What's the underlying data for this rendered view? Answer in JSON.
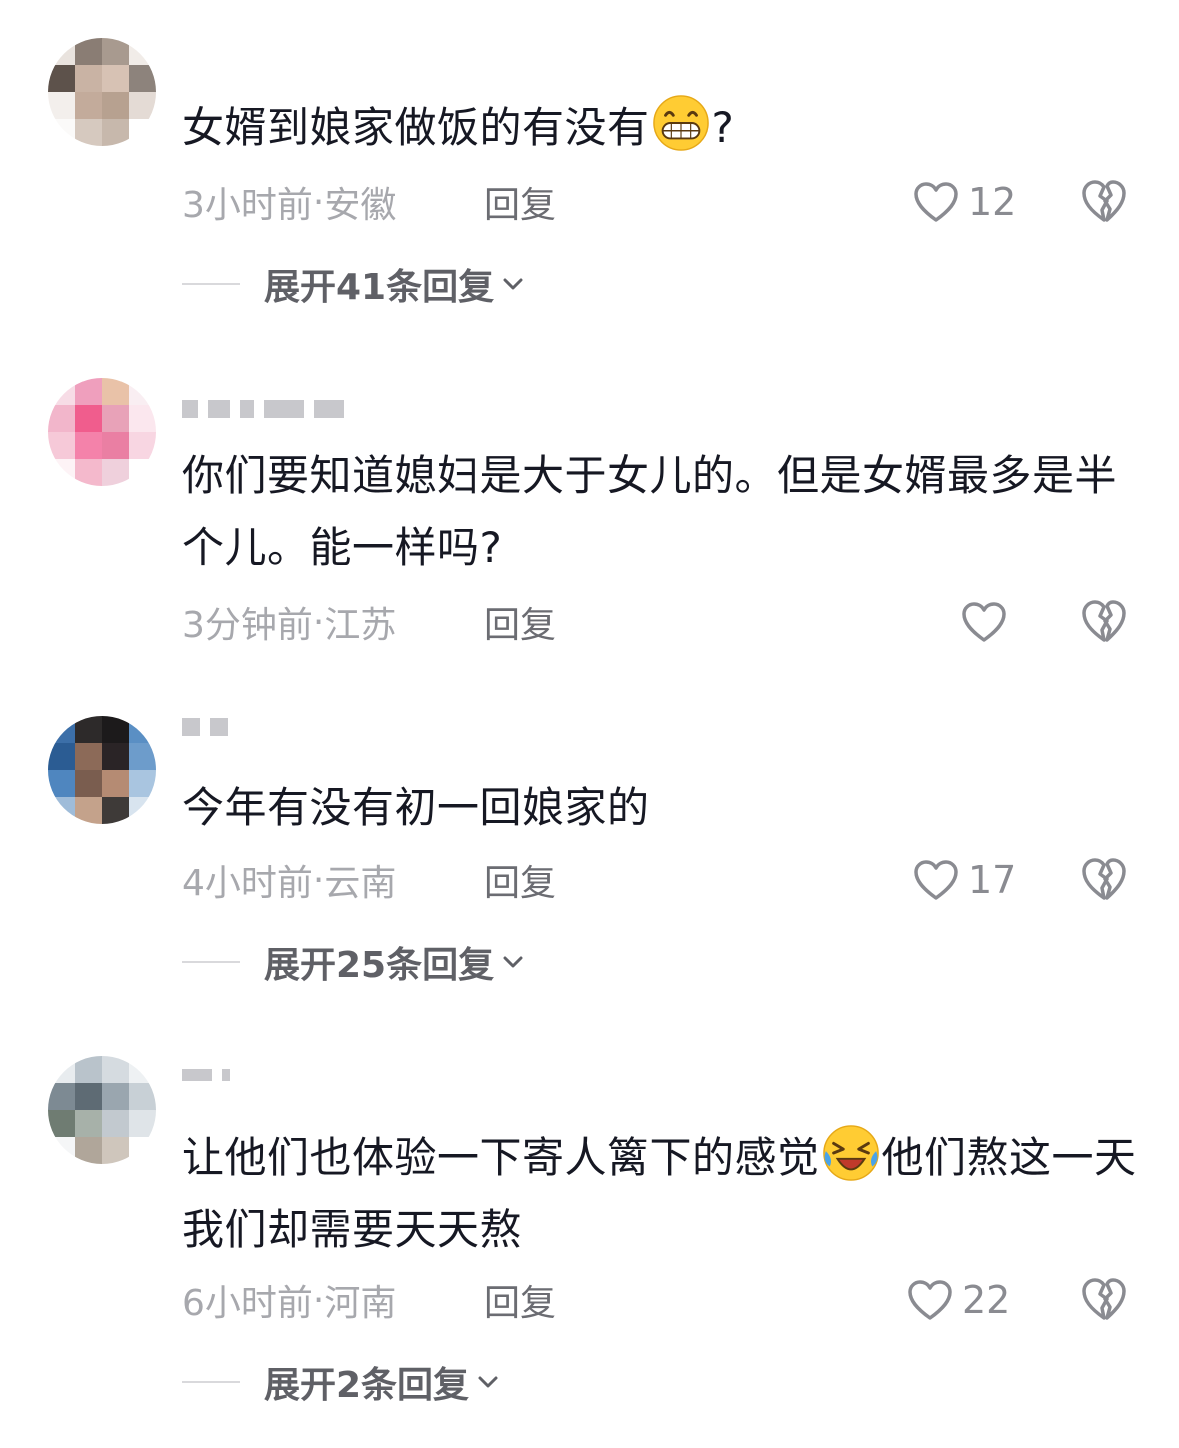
{
  "comments": [
    {
      "text_before_emoji": "女婿到娘家做饭的有没有",
      "emoji": "grinning-face-emoji",
      "text_after_emoji": "?",
      "time": "3小时前",
      "location": "安徽",
      "reply_label": "回复",
      "likes": "12",
      "expand_label": "展开41条回复"
    },
    {
      "text": "你们要知道媳妇是大于女儿的。但是女婿最多是半个儿。能一样吗?",
      "time": "3分钟前",
      "location": "江苏",
      "reply_label": "回复",
      "likes": ""
    },
    {
      "text": "今年有没有初一回娘家的",
      "time": "4小时前",
      "location": "云南",
      "reply_label": "回复",
      "likes": "17",
      "expand_label": "展开25条回复"
    },
    {
      "text_before_emoji": "让他们也体验一下寄人篱下的感觉",
      "emoji": "rolling-laughing-emoji",
      "text_after_emoji": "他们熬这一天 我们却需要天天熬",
      "time": "6小时前",
      "location": "河南",
      "reply_label": "回复",
      "likes": "22",
      "expand_label": "展开2条回复"
    }
  ],
  "meta_separator": " · ",
  "icons": {
    "like": "heart-outline-icon",
    "dislike": "broken-heart-icon",
    "expand": "chevron-down-icon"
  },
  "colors": {
    "text": "#161823",
    "meta": "#a7a8ad",
    "reply": "#6b6c72",
    "icon": "#8a8b91"
  }
}
